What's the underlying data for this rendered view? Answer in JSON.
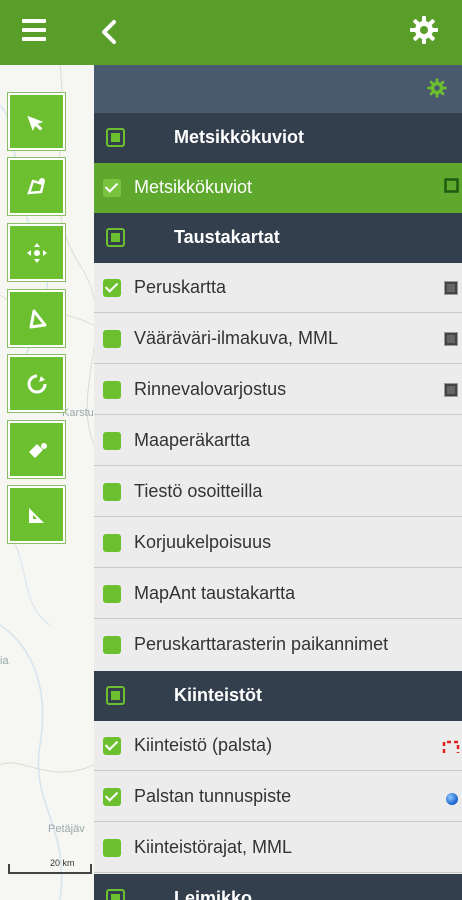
{
  "map": {
    "labels": [
      "Karstula",
      "Petäjäv",
      "ia"
    ],
    "scale_label": "20 km"
  },
  "tools": [
    {
      "name": "select-arrow-tool"
    },
    {
      "name": "draw-area-tool"
    },
    {
      "name": "move-tool"
    },
    {
      "name": "polygon-tool"
    },
    {
      "name": "circle-tool"
    },
    {
      "name": "fill-tool"
    },
    {
      "name": "measure-tool"
    }
  ],
  "panel": {
    "groups": [
      {
        "title": "Metsikkökuviot"
      },
      {
        "title": "Taustakartat"
      },
      {
        "title": "Kiinteistöt"
      },
      {
        "title": "Leimikko"
      }
    ],
    "layers": {
      "metsikko": [
        {
          "label": "Metsikkökuviot",
          "checked": true,
          "legend": "green-square-outline"
        }
      ],
      "tausta": [
        {
          "label": "Peruskartta",
          "checked": true,
          "legend": "dark-square"
        },
        {
          "label": "Vääräväri-ilmakuva, MML",
          "checked": false,
          "legend": "dark-square"
        },
        {
          "label": "Rinnevalovarjostus",
          "checked": false,
          "legend": "dark-square"
        },
        {
          "label": "Maaperäkartta",
          "checked": false
        },
        {
          "label": "Tiestö osoitteilla",
          "checked": false
        },
        {
          "label": "Korjuukelpoisuus",
          "checked": false
        },
        {
          "label": "MapAnt taustakartta",
          "checked": false
        },
        {
          "label": "Peruskarttarasterin paikannimet",
          "checked": false
        }
      ],
      "kiinteisto": [
        {
          "label": "Kiinteistö (palsta)",
          "checked": true,
          "legend": "red-dashed-boundary"
        },
        {
          "label": "Palstan tunnuspiste",
          "checked": true,
          "legend": "blue-dot"
        },
        {
          "label": "Kiinteistörajat, MML",
          "checked": false
        }
      ]
    }
  },
  "colors": {
    "topbar": "#5a9e2a",
    "accent": "#6cbf2f",
    "group_header": "#333f4d",
    "panel_top": "#4a5a6e"
  }
}
